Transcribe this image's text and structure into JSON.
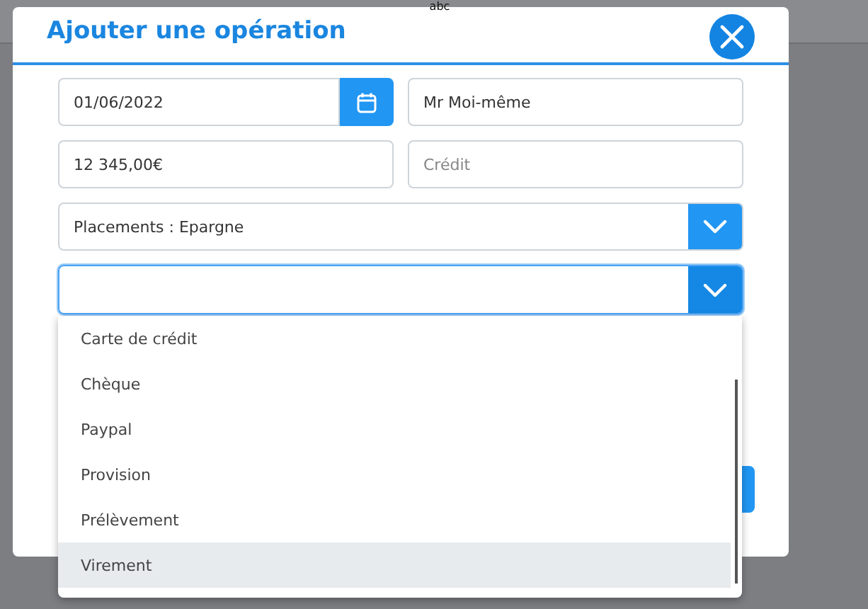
{
  "background": {
    "text": "abc"
  },
  "dialog": {
    "title": "Ajouter une opération",
    "fields": [
      {
        "kind": "date",
        "value": "01/06/2022"
      },
      {
        "kind": "text",
        "value": "Mr Moi-même"
      },
      {
        "kind": "text",
        "value": "12 345,00€"
      },
      {
        "kind": "text",
        "placeholder": "Crédit"
      }
    ],
    "selects": [
      {
        "value": "Placements : Epargne",
        "focused": false
      },
      {
        "focused": true,
        "expanded": true
      }
    ],
    "dropdown": {
      "options": [
        {
          "label": "Carte de crédit",
          "selected": false
        },
        {
          "label": "Chèque",
          "selected": false
        },
        {
          "label": "Paypal",
          "selected": false
        },
        {
          "label": "Provision",
          "selected": false
        },
        {
          "label": "Prélèvement",
          "selected": false
        },
        {
          "label": "Virement",
          "selected": true
        }
      ]
    }
  }
}
